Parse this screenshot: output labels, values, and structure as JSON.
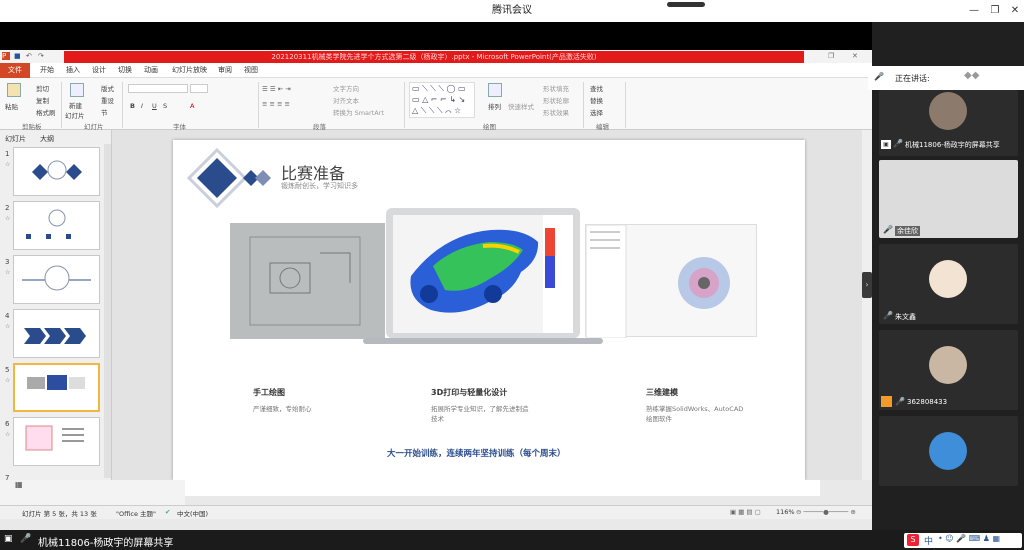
{
  "window": {
    "title": "腾讯会议"
  },
  "ppt": {
    "title": "202120311机械类学院先进学个方式选第二级（杨政宇）.pptx - Microsoft PowerPoint(产品激活失败)",
    "tabs": [
      "文件",
      "开始",
      "插入",
      "设计",
      "切换",
      "动画",
      "幻灯片放映",
      "审阅",
      "视图"
    ],
    "ribbon": {
      "clipboard": {
        "paste": "粘贴",
        "cut": "剪切",
        "copy": "复制",
        "format_painter": "格式刷",
        "label": "剪贴板"
      },
      "slides": {
        "new_slide": "新建",
        "new_slide2": "幻灯片",
        "layout": "版式",
        "reset": "重设",
        "section": "节",
        "label": "幻灯片"
      },
      "font_label": "字体",
      "paragraph": {
        "text_direction": "文字方向",
        "align_text": "对齐文本",
        "smartart": "转换为 SmartArt",
        "label": "段落"
      },
      "drawing": {
        "arrange": "排列",
        "quick_styles": "快速样式",
        "fill": "形状填充",
        "outline": "形状轮廓",
        "effects": "形状效果",
        "label": "绘图"
      },
      "editing": {
        "find": "查找",
        "replace": "替换",
        "select": "选择",
        "label": "编辑"
      }
    },
    "panel_tabs": [
      "幻灯片",
      "大纲"
    ],
    "slide_numbers": [
      "1",
      "2",
      "3",
      "4",
      "5",
      "6",
      "7"
    ],
    "slide": {
      "heading": "比赛准备",
      "subheading": "锻炼耐创长，学习知识多",
      "col1_title": "手工绘图",
      "col1_text": "严谨细致，专始耐心",
      "col2_title": "3D打印与轻量化设计",
      "col2_text": "拓展所学专业知识，了解先进制造技术",
      "col3_title": "三维建模",
      "col3_text": "熟练掌握SolidWorks、AutoCAD绘图软件",
      "bottom_line": "大一开始训练，连续两年坚持训练（每个周末）"
    },
    "status": {
      "slide_info": "幻灯片 第 5 张，共 13 张",
      "theme": "\"Office 主题\"",
      "language": "中文(中国)",
      "zoom": "116%"
    }
  },
  "meeting": {
    "speaking_label": "正在讲话:",
    "participants": [
      {
        "name": "机械11806-杨政宇的屏幕共享"
      },
      {
        "name": "余佳欣"
      },
      {
        "name": "朱文鑫"
      },
      {
        "name": "362808433"
      },
      {
        "name": ""
      }
    ],
    "bottom_share_label": "机械11806-杨政宇的屏幕共享",
    "tray": [
      "中"
    ]
  }
}
